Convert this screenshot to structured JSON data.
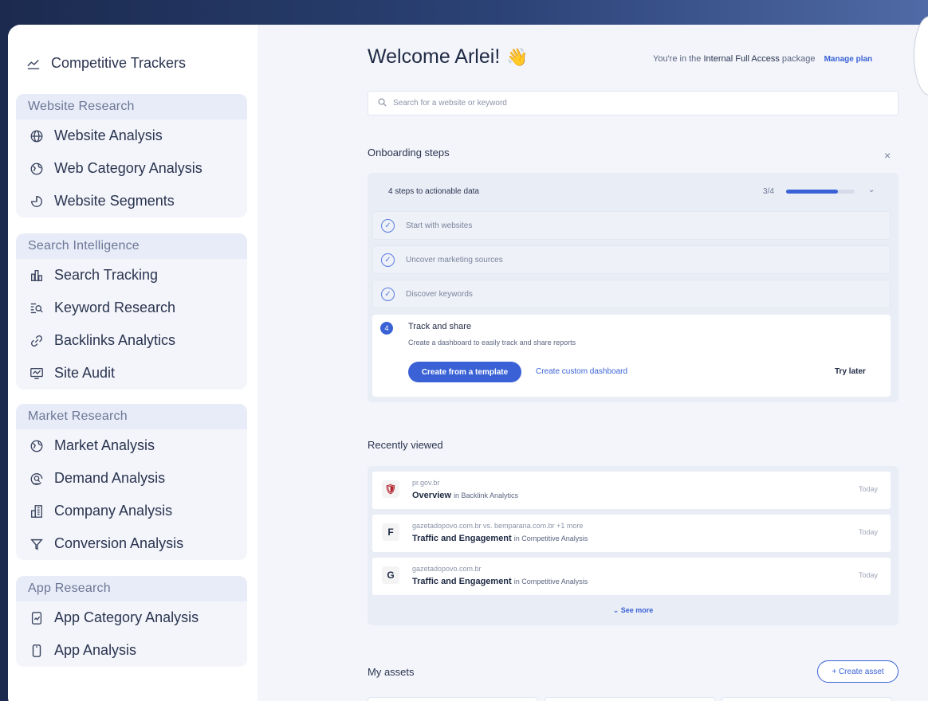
{
  "sidebar": {
    "top_item": "Competitive Trackers",
    "groups": [
      {
        "title": "Website Research",
        "items": [
          {
            "label": "Website Analysis",
            "icon": "globe-icon"
          },
          {
            "label": "Web Category Analysis",
            "icon": "category-globe-icon"
          },
          {
            "label": "Website Segments",
            "icon": "pie-segment-icon"
          }
        ]
      },
      {
        "title": "Search Intelligence",
        "items": [
          {
            "label": "Search Tracking",
            "icon": "bar-chart-icon"
          },
          {
            "label": "Keyword Research",
            "icon": "keyword-search-icon"
          },
          {
            "label": "Backlinks Analytics",
            "icon": "link-icon"
          },
          {
            "label": "Site Audit",
            "icon": "audit-icon"
          }
        ]
      },
      {
        "title": "Market Research",
        "items": [
          {
            "label": "Market Analysis",
            "icon": "market-globe-icon"
          },
          {
            "label": "Demand Analysis",
            "icon": "demand-icon"
          },
          {
            "label": "Company Analysis",
            "icon": "building-icon"
          },
          {
            "label": "Conversion Analysis",
            "icon": "funnel-icon"
          }
        ]
      },
      {
        "title": "App Research",
        "items": [
          {
            "label": "App Category Analysis",
            "icon": "app-category-icon"
          },
          {
            "label": "App Analysis",
            "icon": "phone-icon"
          }
        ]
      }
    ]
  },
  "header": {
    "welcome": "Welcome Arlei!",
    "wave": "👋",
    "package_prefix": "You're in the",
    "package_name": "Internal Full Access",
    "package_suffix": "package",
    "manage_plan": "Manage plan"
  },
  "search": {
    "placeholder": "Search for a website or keyword"
  },
  "onboarding": {
    "title": "Onboarding steps",
    "close": "×",
    "header": "4 steps to actionable data",
    "progress_text": "3/4",
    "progress_fraction": 0.75,
    "completed_steps": [
      "Start with websites",
      "Uncover marketing sources",
      "Discover keywords"
    ],
    "active_step": {
      "number": "4",
      "title": "Track and share",
      "description": "Create a dashboard to easily track and share reports",
      "primary_button": "Create from a template",
      "secondary_link": "Create custom dashboard",
      "later_link": "Try later"
    }
  },
  "recently_viewed": {
    "title": "Recently viewed",
    "items": [
      {
        "domain": "pr.gov.br",
        "title": "Overview",
        "context": "in Backlink Analytics",
        "when": "Today",
        "favicon": "🛡"
      },
      {
        "domain": "gazetadopovo.com.br  vs.  bemparana.com.br  +1 more",
        "title": "Traffic and Engagement",
        "context": "in Competitive Analysis",
        "when": "Today",
        "favicon": "F"
      },
      {
        "domain": "gazetadopovo.com.br",
        "title": "Traffic and Engagement",
        "context": "in Competitive Analysis",
        "when": "Today",
        "favicon": "G"
      }
    ],
    "see_more": "See more"
  },
  "assets": {
    "title": "My assets",
    "create": "+ Create asset"
  }
}
